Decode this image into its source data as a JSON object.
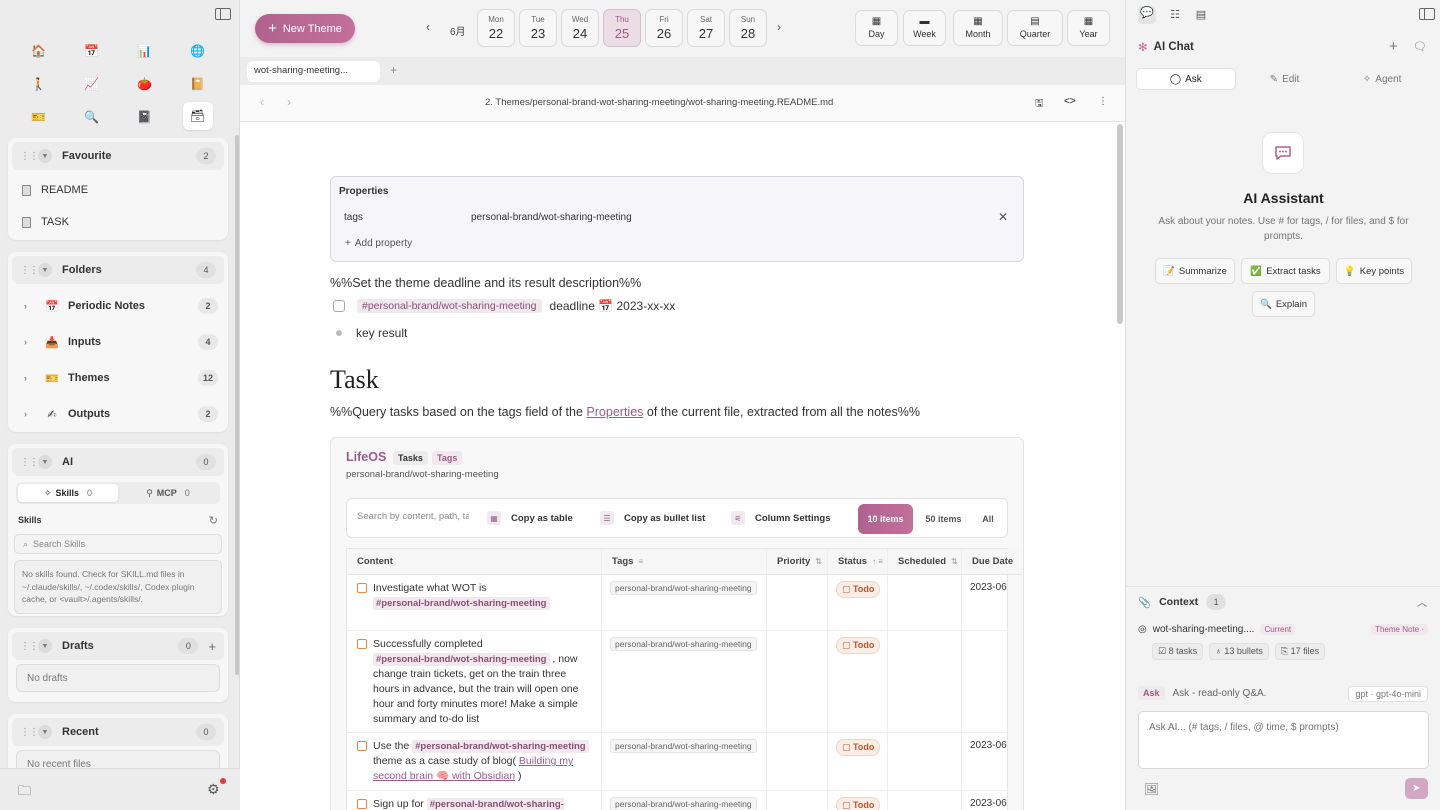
{
  "sidebar": {
    "icons": [
      "house-icon",
      "calendar-icon",
      "bar-chart-icon",
      "globe-icon",
      "walking-icon",
      "line-chart-icon",
      "tomato-icon",
      "notebook-icon",
      "ticket-icon",
      "magnifier-icon",
      "book-icon",
      "box-icon"
    ],
    "favourite": {
      "title": "Favourite",
      "count": "2",
      "items": [
        "README",
        "TASK"
      ]
    },
    "folders": {
      "title": "Folders",
      "count": "4",
      "items": [
        {
          "label": "Periodic Notes",
          "count": "2",
          "icon": "calendar-icon"
        },
        {
          "label": "Inputs",
          "count": "4",
          "icon": "inbox-icon"
        },
        {
          "label": "Themes",
          "count": "12",
          "icon": "ticket-icon"
        },
        {
          "label": "Outputs",
          "count": "2",
          "icon": "writing-hand-icon"
        }
      ]
    },
    "ai": {
      "title": "AI",
      "count": "0",
      "tab_skills": "Skills",
      "tab_skills_count": "0",
      "tab_mcp": "MCP",
      "tab_mcp_count": "0",
      "skills_label": "Skills",
      "search_placeholder": "Search Skills",
      "empty_text": "No skills found. Check for SKILL.md files in ~/.claude/skills/, ~/.codex/skills/, Codex plugin cache, or <vault>/.agents/skills/."
    },
    "drafts": {
      "title": "Drafts",
      "count": "0",
      "empty": "No drafts"
    },
    "recent": {
      "title": "Recent",
      "count": "0",
      "empty": "No recent files"
    }
  },
  "topbar": {
    "new_theme": "New Theme",
    "month": "6月",
    "days": [
      {
        "name": "Mon",
        "num": "22"
      },
      {
        "name": "Tue",
        "num": "23"
      },
      {
        "name": "Wed",
        "num": "24"
      },
      {
        "name": "Thu",
        "num": "25"
      },
      {
        "name": "Fri",
        "num": "26"
      },
      {
        "name": "Sat",
        "num": "27"
      },
      {
        "name": "Sun",
        "num": "28"
      }
    ],
    "periods": [
      "Day",
      "Week",
      "Month",
      "Quarter",
      "Year"
    ]
  },
  "tabs": {
    "active": "wot-sharing-meeting..."
  },
  "path": "2. Themes/personal-brand-wot-sharing-meeting/wot-sharing-meeting.README.md",
  "editor": {
    "properties_title": "Properties",
    "prop_key": "tags",
    "prop_value": "personal-brand/wot-sharing-meeting",
    "add_property": "Add property",
    "theme_comment": "%%Set the theme deadline and its result description%%",
    "task_tag": "#personal-brand/wot-sharing-meeting",
    "task_text": "deadline 📅 2023-xx-xx",
    "bullet": "key result",
    "heading": "Task",
    "query_pre": "%%Query tasks based on the tags field of the",
    "query_link": "Properties",
    "query_post": "of the current file, extracted from all the notes%%"
  },
  "lifeos": {
    "title": "LifeOS",
    "tab_tasks": "Tasks",
    "tab_tags": "Tags",
    "subtitle": "personal-brand/wot-sharing-meeting",
    "search_placeholder": "Search by content, path, tags...",
    "copy_table": "Copy as table",
    "copy_bullets": "Copy as bullet list",
    "column_settings": "Column Settings",
    "seg_10": "10 items",
    "seg_50": "50 items",
    "seg_all": "All",
    "columns": [
      "Content",
      "Tags",
      "Priority",
      "Status",
      "Scheduled",
      "Due Date"
    ],
    "rows": [
      {
        "pre": "Investigate what WOT is",
        "tag": "#personal-brand/wot-sharing-meeting",
        "post": "",
        "chip": "personal-brand/wot-sharing-meeting",
        "status": "Todo",
        "due": "2023-06"
      },
      {
        "pre": "Successfully completed",
        "tag": "#personal-brand/wot-sharing-meeting",
        "post": ", now change train tickets, get on the train three hours in advance, but the train will open one hour and forty minutes more! Make a simple summary and to-do list",
        "chip": "personal-brand/wot-sharing-meeting",
        "status": "Todo",
        "due": ""
      },
      {
        "pre": "Use the",
        "tag": "#personal-brand/wot-sharing-meeting",
        "post": "theme as a case study of blog(",
        "link": "Building my second brain 🧠 with Obsidian",
        "post2": ")",
        "chip": "personal-brand/wot-sharing-meeting",
        "status": "Todo",
        "due": "2023-06"
      },
      {
        "pre": "Sign up for",
        "tag": "#personal-brand/wot-sharing-meeting",
        "post": "",
        "chip": "personal-brand/wot-sharing-meeting",
        "status": "Todo",
        "due": "2023-06"
      }
    ]
  },
  "right": {
    "title": "AI Chat",
    "mode_ask": "Ask",
    "mode_edit": "Edit",
    "mode_agent": "Agent",
    "assistant_title": "AI Assistant",
    "assistant_desc": "Ask about your notes. Use # for tags, / for files, and $ for prompts.",
    "actions": [
      "Summarize",
      "Extract tasks",
      "Key points",
      "Explain"
    ],
    "context_title": "Context",
    "context_count": "1",
    "context_file": "wot-sharing-meeting....",
    "badge_current": "Current",
    "badge_theme": "Theme Note ·",
    "stat_tasks": "8 tasks",
    "stat_bullets": "13 bullets",
    "stat_files": "17 files",
    "mode_badge": "Ask",
    "mode_desc": "Ask - read-only Q&A.",
    "model": "gpt · gpt-4o-mini",
    "input_placeholder": "Ask AI... (# tags, / files, @ time, $ prompts)"
  },
  "colors": {
    "accent": "#b0628e",
    "accent_light": "#f1e8ee",
    "todo": "#c0572a"
  }
}
